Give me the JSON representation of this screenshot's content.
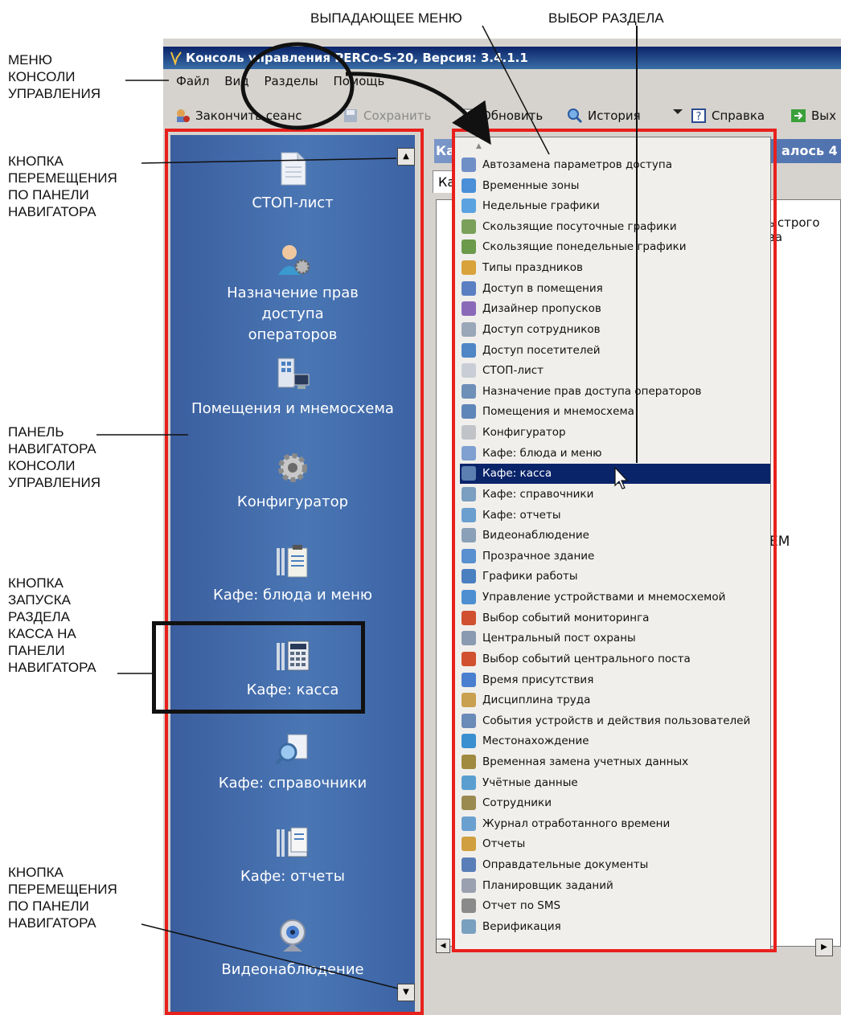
{
  "annotations": {
    "dropdown_menu": "ВЫПАДАЮЩЕЕ МЕНЮ",
    "section_choice": "ВЫБОР РАЗДЕЛА",
    "console_menu": [
      "МЕНЮ",
      "КОНСОЛИ",
      "УПРАВЛЕНИЯ"
    ],
    "nav_move_top": [
      "КНОПКА",
      "ПЕРЕМЕЩЕНИЯ",
      "ПО ПАНЕЛИ",
      "НАВИГАТОРА"
    ],
    "nav_panel": [
      "ПАНЕЛЬ",
      "НАВИГАТОРА",
      "КОНСОЛИ",
      "УПРАВЛЕНИЯ"
    ],
    "kassa_button": [
      "КНОПКА",
      "ЗАПУСКА",
      "РАЗДЕЛА",
      "КАССА НА",
      "ПАНЕЛИ",
      "НАВИГАТОРА"
    ],
    "nav_move_bottom": [
      "КНОПКА",
      "ПЕРЕМЕЩЕНИЯ",
      "ПО ПАНЕЛИ",
      "НАВИГАТОРА"
    ]
  },
  "window": {
    "title": "Консоль управления PERCo-S-20, Версия: 3.4.1.1",
    "menu": [
      "Файл",
      "Вид",
      "Разделы",
      "Помощь"
    ],
    "toolbar": {
      "end_session": "Закончить сеанс",
      "save": "Сохранить",
      "refresh": "Обновить",
      "history": "История",
      "help": "Справка",
      "exit": "Вых"
    }
  },
  "navigator": {
    "items": [
      {
        "label": "СТОП-лист",
        "icon": "document-icon"
      },
      {
        "label": "Назначение прав доступа операторов",
        "icon": "operator-gear-icon"
      },
      {
        "label": "Помещения и мнемосхема",
        "icon": "building-computer-icon"
      },
      {
        "label": "Конфигуратор",
        "icon": "gear-icon"
      },
      {
        "label": "Кафе: блюда и меню",
        "icon": "cutlery-clipboard-icon"
      },
      {
        "label": "Кафе: касса",
        "icon": "cutlery-calculator-icon"
      },
      {
        "label": "Кафе: справочники",
        "icon": "magnifier-document-icon"
      },
      {
        "label": "Кафе: отчеты",
        "icon": "cutlery-folder-icon"
      },
      {
        "label": "Видеонаблюдение",
        "icon": "webcam-icon"
      }
    ]
  },
  "background_fragments": {
    "header_start": "Ка",
    "header_end": "алось 4",
    "tab": "Ка",
    "col1": "ыстрого",
    "col2": "ва",
    "em": "EM"
  },
  "dropdown": {
    "selected": "Кафе: касса",
    "items": [
      "Автозамена параметров доступа",
      "Временные зоны",
      "Недельные графики",
      "Скользящие посуточные графики",
      "Скользящие понедельные графики",
      "Типы праздников",
      "Доступ в помещения",
      "Дизайнер пропусков",
      "Доступ сотрудников",
      "Доступ посетителей",
      "СТОП-лист",
      "Назначение прав доступа операторов",
      "Помещения и мнемосхема",
      "Конфигуратор",
      "Кафе: блюда и меню",
      "Кафе: касса",
      "Кафе: справочники",
      "Кафе: отчеты",
      "Видеонаблюдение",
      "Прозрачное здание",
      "Графики работы",
      "Управление устройствами и мнемосхемой",
      "Выбор событий мониторинга",
      "Центральный пост охраны",
      "Выбор событий центрального поста",
      "Время присутствия",
      "Дисциплина труда",
      "События устройств и действия пользователей",
      "Местонахождение",
      "Временная замена учетных данных",
      "Учётные данные",
      "Сотрудники",
      "Журнал отработанного времени",
      "Отчеты",
      "Оправдательные документы",
      "Планировщик заданий",
      "Отчет по SMS",
      "Верификация"
    ],
    "icon_colors": [
      "#6f8fc7",
      "#4a8fd8",
      "#5aa3e0",
      "#7aa05a",
      "#6a9a4a",
      "#d9a23a",
      "#5b7fc2",
      "#8a6ab8",
      "#9aa7b8",
      "#4f86c6",
      "#c9ced6",
      "#6e8fb8",
      "#5f86b8",
      "#c0c4c8",
      "#7fa0d0",
      "#5a7fb0",
      "#7a9fc0",
      "#6a9fcf",
      "#8aa0b8",
      "#5a8fd0",
      "#4a7fc0",
      "#4d8fd0",
      "#d05030",
      "#8a9ab0",
      "#d05030",
      "#4a7fd0",
      "#c9a050",
      "#6a8ab8",
      "#3a8fd0",
      "#a08a40",
      "#5a9fd0",
      "#9a8a50",
      "#6aa0d0",
      "#d0a040",
      "#5a7fb8",
      "#9aa0b0",
      "#8a8a8a",
      "#7aa0c0"
    ]
  }
}
